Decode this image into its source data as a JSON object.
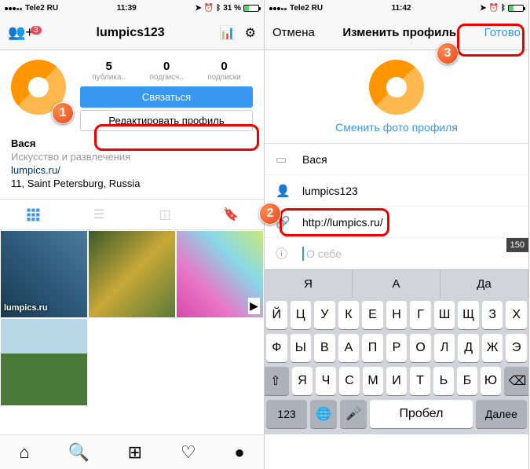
{
  "left": {
    "status": {
      "carrier": "Tele2 RU",
      "time": "11:39",
      "pct": "31 %"
    },
    "nav": {
      "username": "lumpics123",
      "badge": "3"
    },
    "stats": {
      "posts": {
        "n": "5",
        "l": "публика.."
      },
      "followers": {
        "n": "0",
        "l": "подписч.."
      },
      "following": {
        "n": "0",
        "l": "подписки"
      }
    },
    "btn_contact": "Связаться",
    "btn_edit": "Редактировать профиль",
    "bio": {
      "name": "Вася",
      "cat": "Искусство и развлечения",
      "link": "lumpics.ru/",
      "loc": "11, Saint Petersburg, Russia"
    },
    "watermark": "lumpics.ru"
  },
  "right": {
    "status": {
      "carrier": "Tele2 RU",
      "time": "11:42"
    },
    "nav": {
      "cancel": "Отмена",
      "title": "Изменить профиль",
      "done": "Готово"
    },
    "change_photo": "Сменить фото профиля",
    "fields": {
      "name": "Вася",
      "username": "lumpics123",
      "website": "http://lumpics.ru/",
      "bio_ph": "О себе"
    },
    "counter": "150",
    "sugg": [
      "Я",
      "А",
      "Да"
    ],
    "kb": {
      "r1": [
        "Й",
        "Ц",
        "У",
        "К",
        "Е",
        "Н",
        "Г",
        "Ш",
        "Щ",
        "З",
        "Х"
      ],
      "r2": [
        "Ф",
        "Ы",
        "В",
        "А",
        "П",
        "Р",
        "О",
        "Л",
        "Д",
        "Ж",
        "Э"
      ],
      "r3": [
        "Я",
        "Ч",
        "С",
        "М",
        "И",
        "Т",
        "Ь",
        "Б",
        "Ю"
      ],
      "num": "123",
      "space": "Пробел",
      "next": "Далее"
    }
  },
  "callouts": {
    "1": "1",
    "2": "2",
    "3": "3"
  }
}
